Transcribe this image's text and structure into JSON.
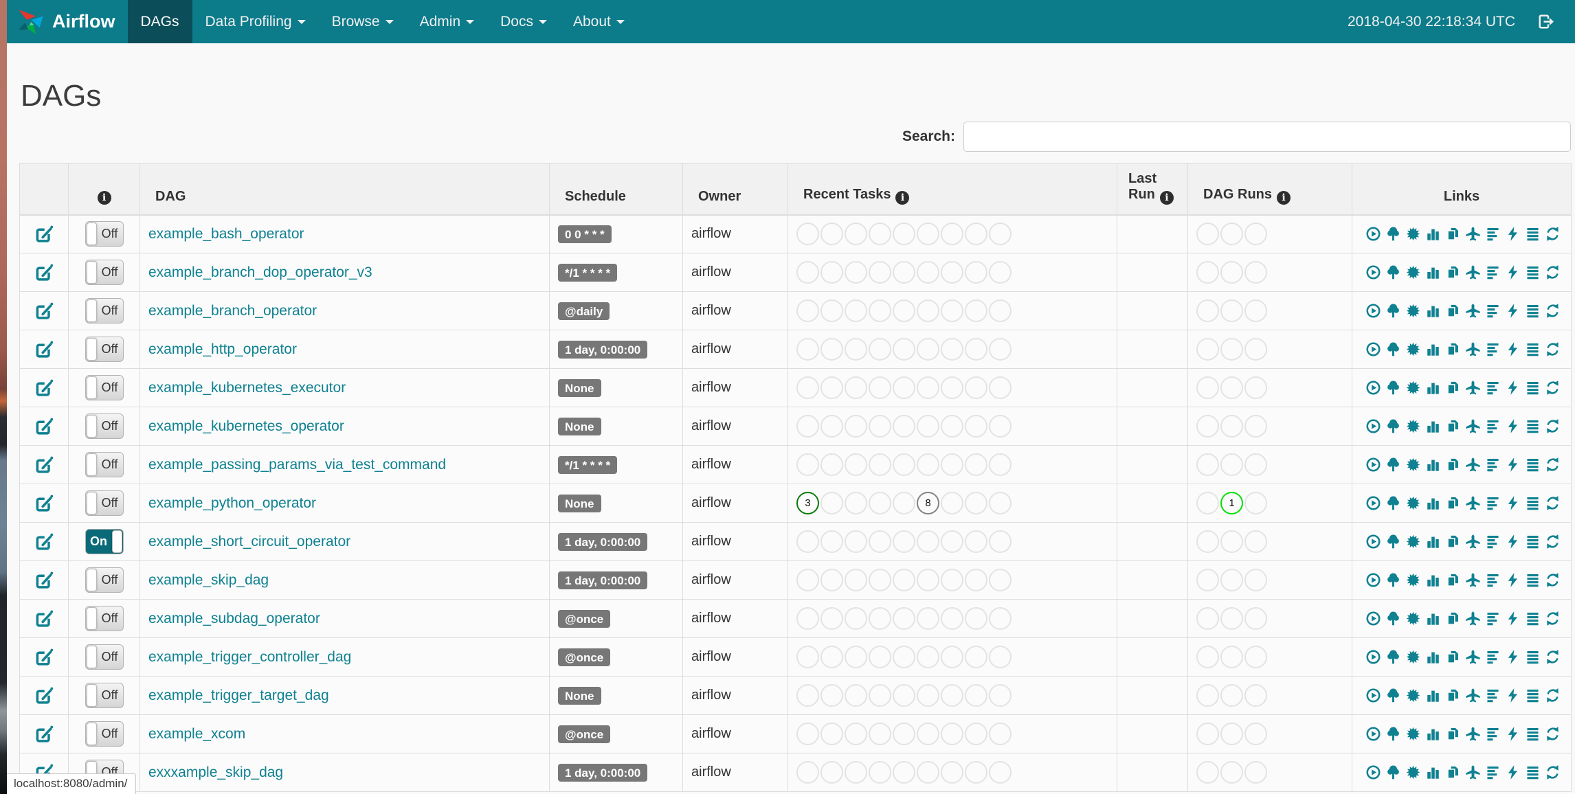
{
  "navbar": {
    "brand": "Airflow",
    "items": [
      {
        "label": "DAGs",
        "active": true,
        "caret": false
      },
      {
        "label": "Data Profiling",
        "active": false,
        "caret": true
      },
      {
        "label": "Browse",
        "active": false,
        "caret": true
      },
      {
        "label": "Admin",
        "active": false,
        "caret": true
      },
      {
        "label": "Docs",
        "active": false,
        "caret": true
      },
      {
        "label": "About",
        "active": false,
        "caret": true
      }
    ],
    "clock": "2018-04-30 22:18:34 UTC"
  },
  "page": {
    "title": "DAGs"
  },
  "search": {
    "label": "Search:",
    "value": ""
  },
  "toggle": {
    "on_label": "On",
    "off_label": "Off"
  },
  "statusbar": {
    "url": "localhost:8080/admin/"
  },
  "colors": {
    "navbar_bg": "#0c7b8a",
    "navbar_active_bg": "#0c4d5a",
    "link_teal": "#0f8191",
    "badge_bg": "#777777"
  },
  "table": {
    "headers": {
      "dag": "DAG",
      "schedule": "Schedule",
      "owner": "Owner",
      "recent_tasks": "Recent Tasks",
      "last_run": "Last Run",
      "dag_runs": "DAG Runs",
      "links": "Links"
    },
    "recent_task_slots": 9,
    "dag_run_slots": 3,
    "links_icons": [
      "trigger-dag",
      "tree-view",
      "graph-view",
      "task-duration",
      "task-tries",
      "landing-times",
      "gantt-view",
      "code-view",
      "logs",
      "refresh"
    ],
    "status_colors": {
      "success": "#0a7a0a",
      "queued": "#828282",
      "running": "#00e000",
      "empty": "#e3e3e3"
    },
    "rows": [
      {
        "name": "example_bash_operator",
        "schedule": "0 0 * * *",
        "owner": "airflow",
        "enabled": false,
        "recent_tasks": [],
        "dag_runs": []
      },
      {
        "name": "example_branch_dop_operator_v3",
        "schedule": "*/1 * * * *",
        "owner": "airflow",
        "enabled": false,
        "recent_tasks": [],
        "dag_runs": []
      },
      {
        "name": "example_branch_operator",
        "schedule": "@daily",
        "owner": "airflow",
        "enabled": false,
        "recent_tasks": [],
        "dag_runs": []
      },
      {
        "name": "example_http_operator",
        "schedule": "1 day, 0:00:00",
        "owner": "airflow",
        "enabled": false,
        "recent_tasks": [],
        "dag_runs": []
      },
      {
        "name": "example_kubernetes_executor",
        "schedule": "None",
        "owner": "airflow",
        "enabled": false,
        "recent_tasks": [],
        "dag_runs": []
      },
      {
        "name": "example_kubernetes_operator",
        "schedule": "None",
        "owner": "airflow",
        "enabled": false,
        "recent_tasks": [],
        "dag_runs": []
      },
      {
        "name": "example_passing_params_via_test_command",
        "schedule": "*/1 * * * *",
        "owner": "airflow",
        "enabled": false,
        "recent_tasks": [],
        "dag_runs": []
      },
      {
        "name": "example_python_operator",
        "schedule": "None",
        "owner": "airflow",
        "enabled": false,
        "recent_tasks": [
          {
            "slot": 0,
            "count": "3",
            "status": "success"
          },
          {
            "slot": 5,
            "count": "8",
            "status": "queued"
          }
        ],
        "dag_runs": [
          {
            "slot": 1,
            "count": "1",
            "status": "running"
          }
        ]
      },
      {
        "name": "example_short_circuit_operator",
        "schedule": "1 day, 0:00:00",
        "owner": "airflow",
        "enabled": true,
        "recent_tasks": [],
        "dag_runs": []
      },
      {
        "name": "example_skip_dag",
        "schedule": "1 day, 0:00:00",
        "owner": "airflow",
        "enabled": false,
        "recent_tasks": [],
        "dag_runs": []
      },
      {
        "name": "example_subdag_operator",
        "schedule": "@once",
        "owner": "airflow",
        "enabled": false,
        "recent_tasks": [],
        "dag_runs": []
      },
      {
        "name": "example_trigger_controller_dag",
        "schedule": "@once",
        "owner": "airflow",
        "enabled": false,
        "recent_tasks": [],
        "dag_runs": []
      },
      {
        "name": "example_trigger_target_dag",
        "schedule": "None",
        "owner": "airflow",
        "enabled": false,
        "recent_tasks": [],
        "dag_runs": []
      },
      {
        "name": "example_xcom",
        "schedule": "@once",
        "owner": "airflow",
        "enabled": false,
        "recent_tasks": [],
        "dag_runs": []
      },
      {
        "name": "exxxample_skip_dag",
        "schedule": "1 day, 0:00:00",
        "owner": "airflow",
        "enabled": false,
        "recent_tasks": [],
        "dag_runs": []
      }
    ]
  }
}
